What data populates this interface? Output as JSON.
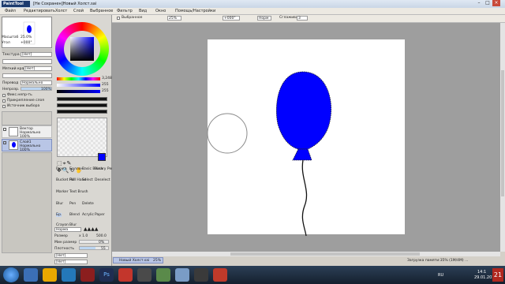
{
  "window": {
    "app_logo": "PaintTool SAI",
    "title": "[Не Сохранен]Новый Холст.sai"
  },
  "menu": [
    "Файл",
    "Редактировать",
    "Холст",
    "Слой",
    "Выбранное",
    "Фильтр",
    "Вид",
    "Окно",
    "Помощь/Настройки"
  ],
  "view_toolbar": {
    "select_label": "Выбранное",
    "zoom": "25%",
    "rotation": "+000°",
    "mode": "Норм",
    "stabilizer_label": "Сглаживание",
    "stabilizer_value": "3"
  },
  "navigator": {
    "zoom_label": "Масштаб",
    "zoom_value": "25.0%",
    "angle_label": "Угол",
    "angle_value": "+000°"
  },
  "color": {
    "ring_selected": "#1010e0",
    "rgb_r": "3,248",
    "rgb_g": "255",
    "rgb_b": "255",
    "primary": "#0000ff"
  },
  "layer_props": {
    "texture_label": "Текстура",
    "texture_value": "[Нет]",
    "edge_label": "Мягкий край",
    "edge_value": "[Нет]",
    "mode_label": "Перевод",
    "mode_value": "Нормально",
    "opacity_label": "Непрозр.",
    "opacity_value": "100%",
    "check1": "Фикс.непр-ть",
    "check2": "Прикрепление слоя",
    "check3": "Источник выбора"
  },
  "layers": [
    {
      "name": "Вектор",
      "mode": "Нормально",
      "opacity": "100%"
    },
    {
      "name": "Слой1",
      "mode": "Нормально",
      "opacity": "100%"
    }
  ],
  "tools": [
    [
      "Ручка",
      "Баллон.",
      "Basic Brush",
      "Binary Pen"
    ],
    [
      "Bucket Fill",
      "Pull Hand",
      "Select",
      "Deselect"
    ],
    [
      "Marker",
      "Text Brush",
      "",
      ""
    ],
    [
      "Blur",
      "Pen",
      "Delete",
      ""
    ],
    [
      "Бр.",
      "Blend",
      "Acrylic",
      "Paper"
    ],
    [
      "Crayon",
      "Blur",
      "",
      ""
    ]
  ],
  "brush": {
    "mode": "Норма",
    "size_label": "Размер",
    "size_mult": "x 1.0",
    "size_value": "500.0",
    "min_label": "Мин размер",
    "min_value": "0%",
    "density_label": "Плотность",
    "density_value": "55",
    "shape_label": "[Нет]",
    "texture_label": "[Нет]"
  },
  "doc_tab": {
    "name": "Новый Холст.sai",
    "zoom": "25%"
  },
  "statusbar": "Загрузка памяти:35% (1M/4M) ...",
  "taskbar": {
    "lang": "RU",
    "time": "14:1",
    "date": "29.01.201",
    "num": "21"
  }
}
